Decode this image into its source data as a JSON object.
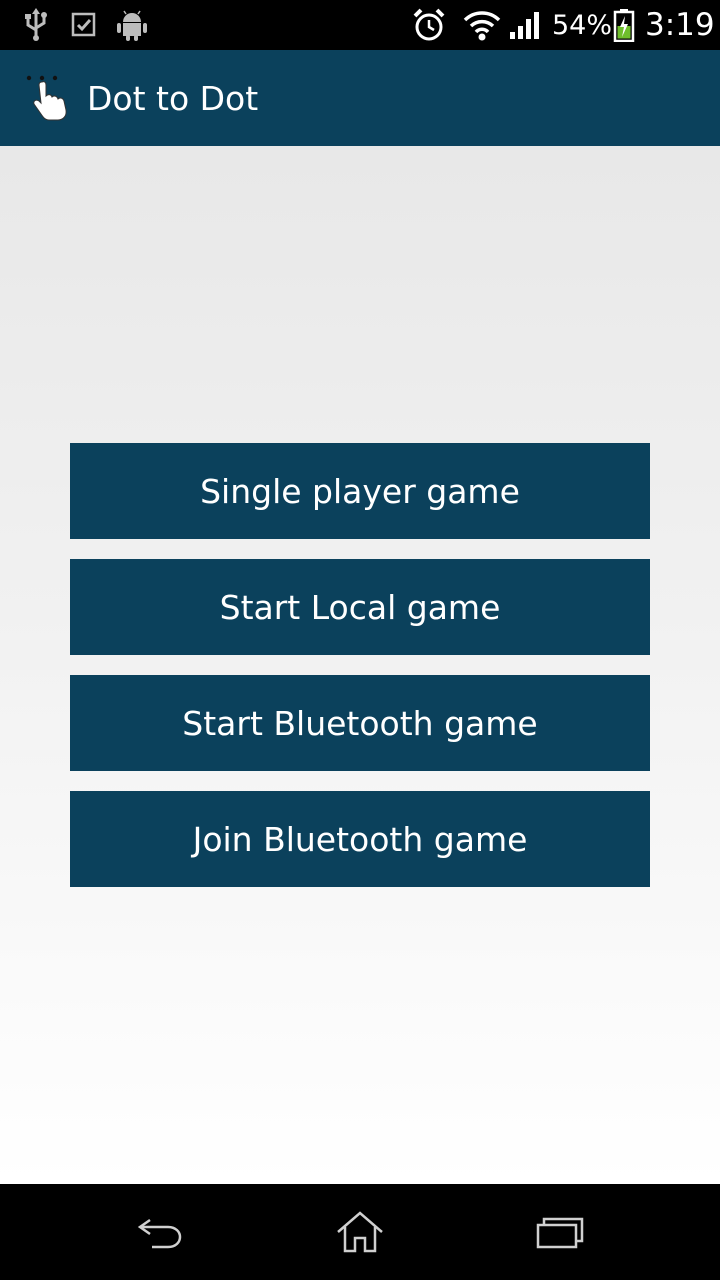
{
  "status_bar": {
    "icons": [
      "usb-icon",
      "checkbox-icon",
      "android-icon",
      "alarm-clock-icon",
      "wifi-icon",
      "signal-icon",
      "battery-charging-icon"
    ],
    "battery_percent": "54%",
    "time": "3:19"
  },
  "action_bar": {
    "title": "Dot to Dot",
    "icon": "tapping-hand-icon",
    "background": "#0b415c"
  },
  "menu": {
    "buttons": [
      {
        "label": "Single player game"
      },
      {
        "label": "Start Local game"
      },
      {
        "label": "Start Bluetooth game"
      },
      {
        "label": "Join Bluetooth game"
      }
    ],
    "button_color": "#0b415c",
    "text_color": "#ffffff"
  },
  "nav_bar": {
    "icons": [
      "back-icon",
      "home-icon",
      "recents-icon"
    ]
  }
}
